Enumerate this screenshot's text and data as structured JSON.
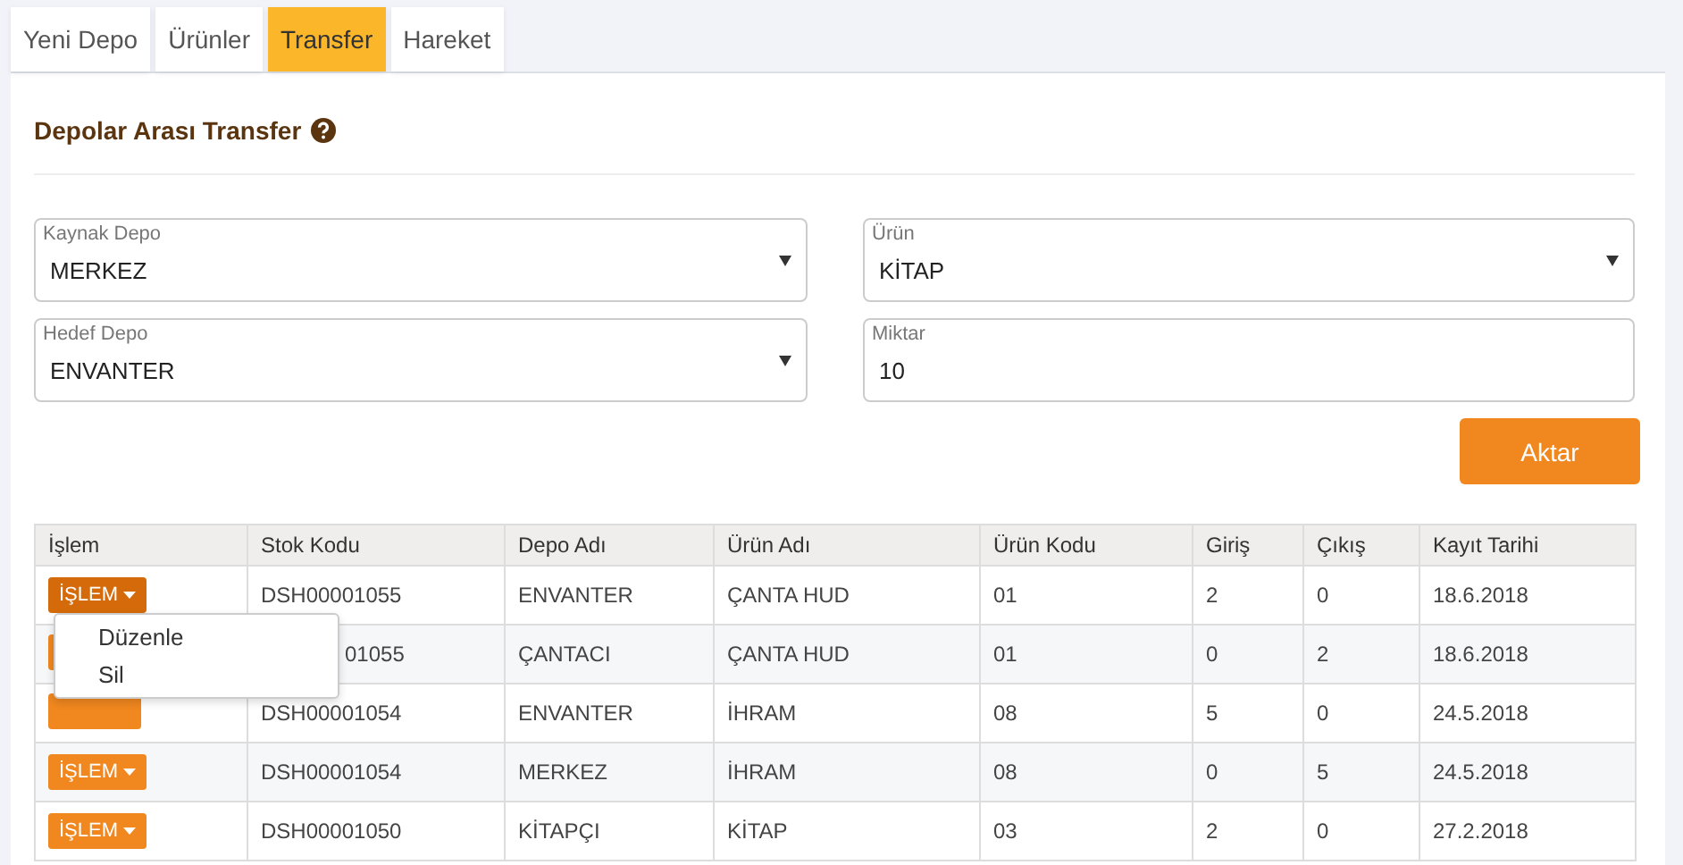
{
  "tabs": [
    {
      "label": "Yeni Depo",
      "selected": false
    },
    {
      "label": "Ürünler",
      "selected": false
    },
    {
      "label": "Transfer",
      "selected": true
    },
    {
      "label": "Hareket",
      "selected": false
    }
  ],
  "heading": "Depolar Arası Transfer",
  "fields": [
    {
      "label": "Kaynak Depo",
      "value": "MERKEZ",
      "kind": "select"
    },
    {
      "label": "Ürün",
      "value": "KİTAP",
      "kind": "select"
    },
    {
      "label": "Hedef Depo",
      "value": "ENVANTER",
      "kind": "select"
    },
    {
      "label": "Miktar",
      "value": "10",
      "kind": "input"
    }
  ],
  "submit": "Aktar",
  "table": {
    "columns": [
      "İşlem",
      "Stok Kodu",
      "Depo Adı",
      "Ürün Adı",
      "Ürün Kodu",
      "Giriş",
      "Çıkış",
      "Kayıt Tarihi"
    ],
    "rows": [
      {
        "open": true,
        "covered": false,
        "cells": [
          "İŞLEM",
          "DSH00001055",
          "ENVANTER",
          "ÇANTA HUD",
          "01",
          "2",
          "0",
          "18.6.2018"
        ]
      },
      {
        "open": false,
        "covered": true,
        "cells": [
          "",
          "01055",
          "ÇANTACI",
          "ÇANTA HUD",
          "01",
          "0",
          "2",
          "18.6.2018"
        ]
      },
      {
        "open": false,
        "covered": true,
        "cells": [
          "",
          "DSH00001054",
          "ENVANTER",
          "İHRAM",
          "08",
          "5",
          "0",
          "24.5.2018"
        ]
      },
      {
        "open": false,
        "covered": false,
        "cells": [
          "İŞLEM",
          "DSH00001054",
          "MERKEZ",
          "İHRAM",
          "08",
          "0",
          "5",
          "24.5.2018"
        ]
      },
      {
        "open": false,
        "covered": false,
        "cells": [
          "İŞLEM",
          "DSH00001050",
          "KİTAPÇI",
          "KİTAP",
          "03",
          "2",
          "0",
          "27.2.2018"
        ]
      }
    ]
  },
  "menu": [
    "Düzenle",
    "Sil"
  ]
}
